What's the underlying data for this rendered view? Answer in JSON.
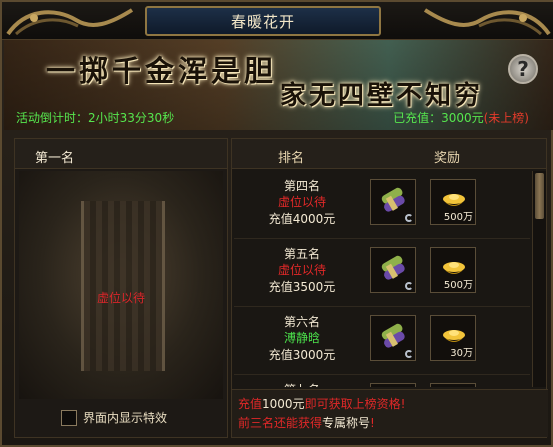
{
  "window": {
    "title": "春暖花开"
  },
  "banner": {
    "slogan_line1": "一掷千金浑是胆",
    "slogan_line2": "家无四壁不知穷",
    "help_glyph": "?",
    "countdown_label": "活动倒计时：",
    "countdown_value": "2小时33分30秒",
    "recharge_label": "已充值：",
    "recharge_amount": "3000元",
    "recharge_status": "(未上榜)"
  },
  "left_panel": {
    "rank_title": "第一名",
    "holder": "虚位以待",
    "effects_checkbox_label": "界面内显示特效",
    "effects_checked": false
  },
  "table": {
    "header_rank": "排名",
    "header_reward": "奖励",
    "rows": [
      {
        "rank": "第四名",
        "holder": "虚位以待",
        "holder_taken": false,
        "requirement": "充值4000元",
        "gold": "500万"
      },
      {
        "rank": "第五名",
        "holder": "虚位以待",
        "holder_taken": false,
        "requirement": "充值3500元",
        "gold": "500万"
      },
      {
        "rank": "第六名",
        "holder": "溥静晗",
        "holder_taken": true,
        "requirement": "充值3000元",
        "gold": "30万"
      },
      {
        "rank": "第七名",
        "holder": "",
        "holder_taken": false,
        "requirement": "",
        "gold": ""
      }
    ]
  },
  "notice": {
    "line1_prefix": "充值",
    "line1_amount": "1000元",
    "line1_suffix": "即可获取上榜资格!",
    "line2_prefix": "前三名还能获得",
    "line2_highlight": "专属称号",
    "line2_suffix": "!"
  },
  "colors": {
    "accent_green": "#56e64e",
    "accent_red": "#e02828",
    "gold": "#c9a862"
  }
}
